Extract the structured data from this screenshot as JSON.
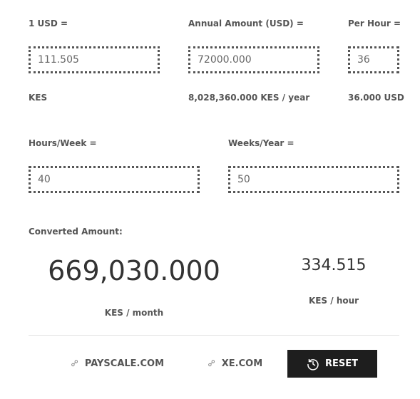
{
  "rate": {
    "label": "1 USD =",
    "value": "111.505",
    "unit": "KES"
  },
  "annual": {
    "label": "Annual Amount (USD) =",
    "value": "72000.000",
    "result": "8,028,360.000 KES / year"
  },
  "per_hour": {
    "label": "Per Hour =",
    "value": "36",
    "result": "36.000 USD"
  },
  "hours_week": {
    "label": "Hours/Week =",
    "value": "40"
  },
  "weeks_year": {
    "label": "Weeks/Year =",
    "value": "50"
  },
  "converted": {
    "label": "Converted Amount:",
    "monthly": "669,030.000",
    "monthly_unit": "KES / month",
    "hourly": "334.515",
    "hourly_unit": "KES / hour"
  },
  "actions": {
    "payscale": "PAYSCALE.COM",
    "xe": "XE.COM",
    "reset": "RESET"
  }
}
